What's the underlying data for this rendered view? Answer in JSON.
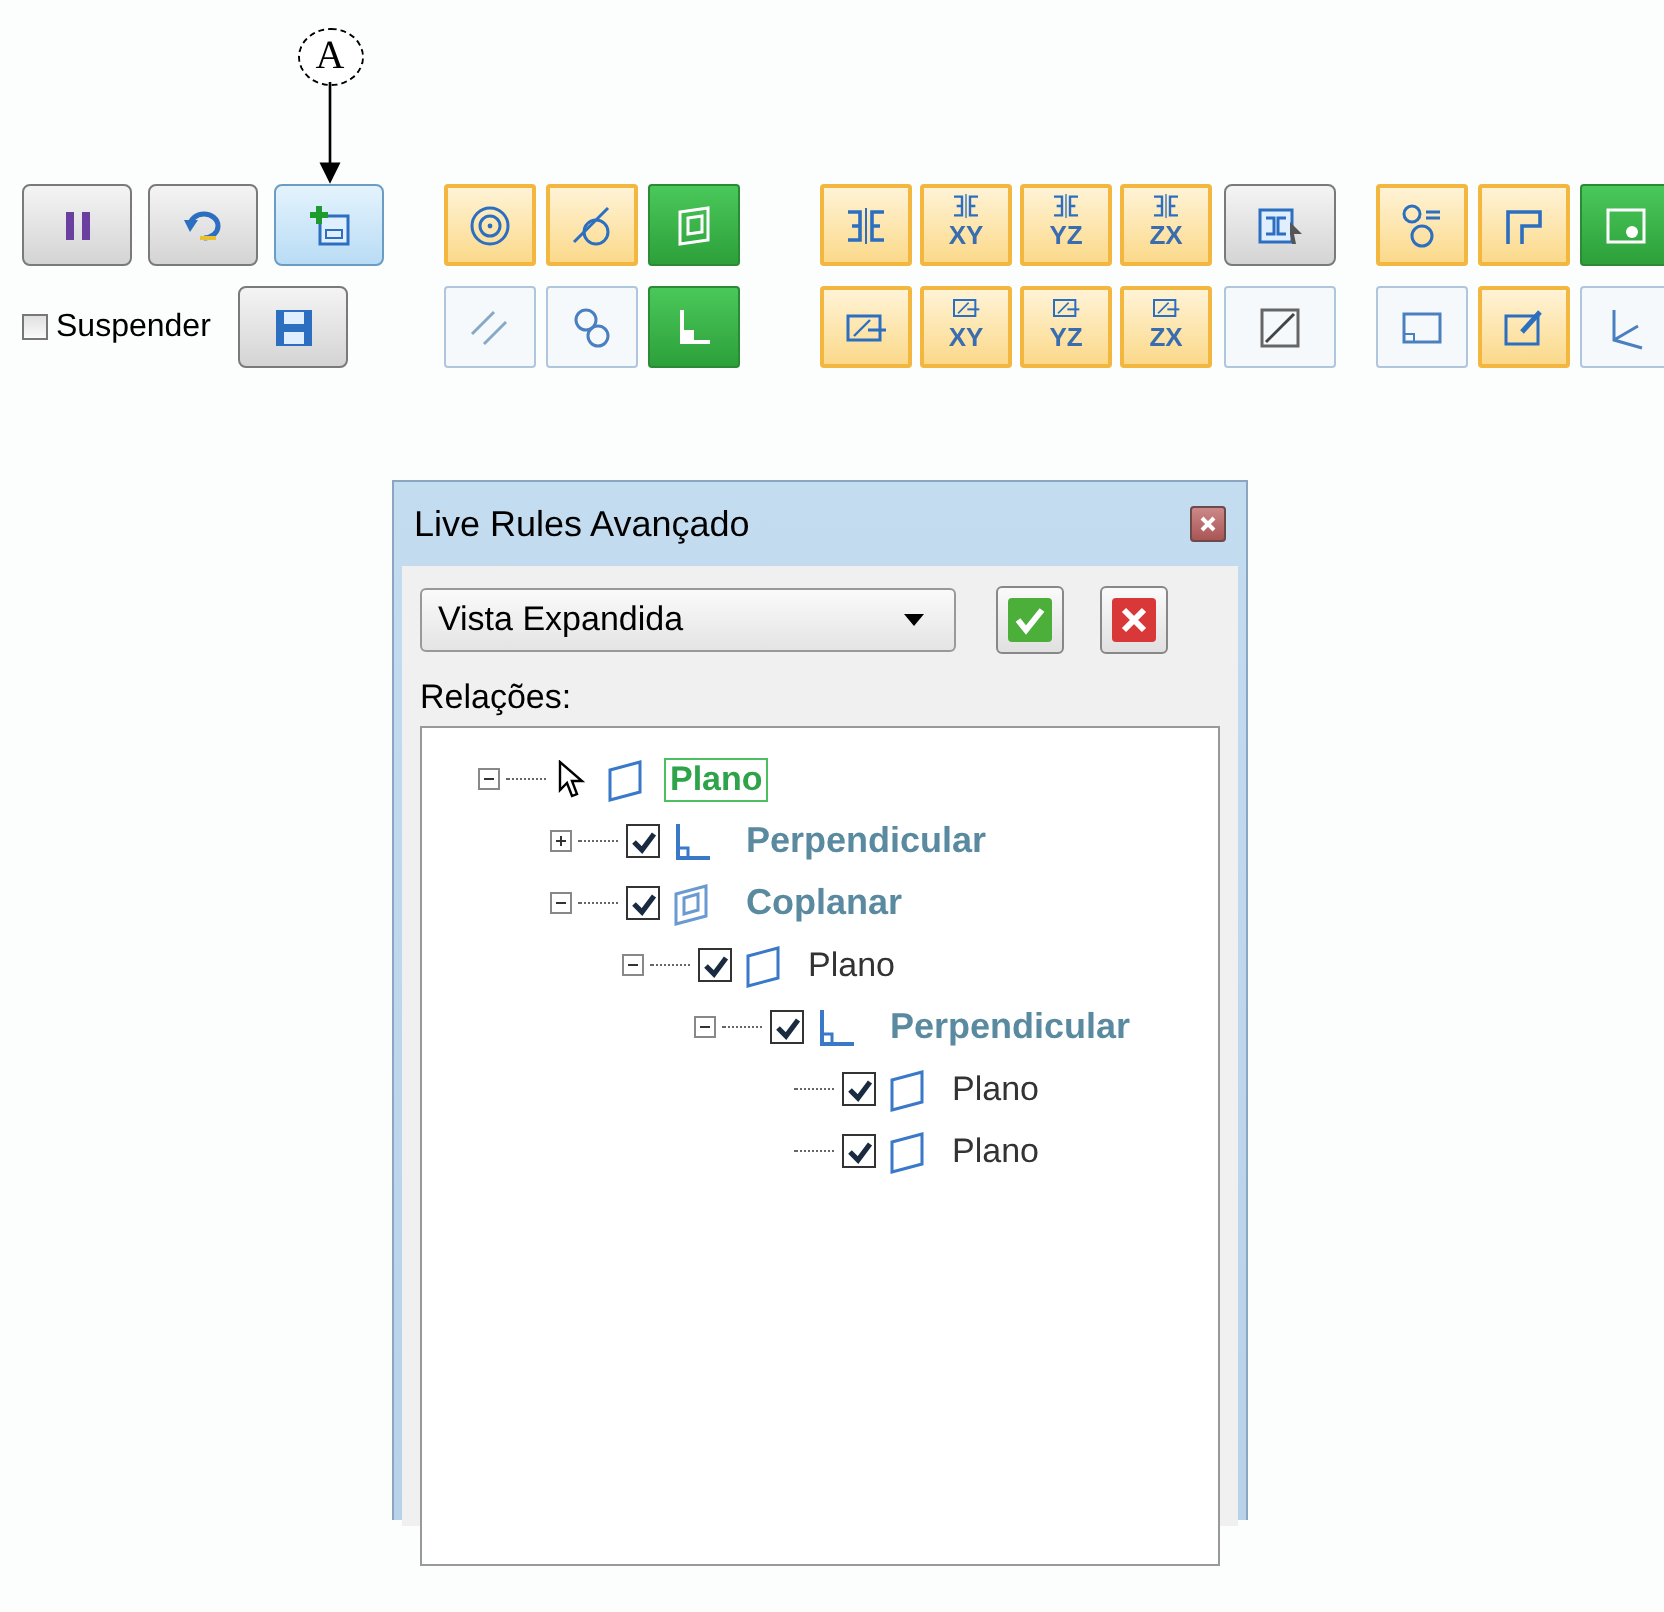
{
  "callout": {
    "label": "A"
  },
  "toolbar": {
    "rows": [
      {
        "groups": [
          [
            {
              "kind": "pause",
              "active": false
            },
            {
              "kind": "undo",
              "active": false
            },
            {
              "kind": "add-plane",
              "active": true
            }
          ],
          [
            {
              "kind": "concentric",
              "on": true,
              "active": false
            },
            {
              "kind": "tangent",
              "on": true,
              "active": false
            },
            {
              "kind": "coplanar",
              "on": true,
              "active": true
            }
          ],
          [
            {
              "kind": "symmetric",
              "on": true,
              "active": false
            },
            {
              "kind": "symmetric",
              "on": true,
              "active": false,
              "label": "XY"
            },
            {
              "kind": "symmetric",
              "on": true,
              "active": false,
              "label": "YZ"
            },
            {
              "kind": "symmetric",
              "on": true,
              "active": false,
              "label": "ZX"
            },
            {
              "kind": "symmetric-select",
              "active": false
            }
          ],
          [
            {
              "kind": "equal-circles",
              "on": true,
              "active": false
            },
            {
              "kind": "step",
              "on": true,
              "active": false
            },
            {
              "kind": "region",
              "on": true,
              "active": true
            }
          ]
        ]
      },
      {
        "groups": [
          [
            {
              "kind": "checkbox",
              "label": "Suspender",
              "checked": false
            },
            {
              "kind": "save",
              "active": false
            }
          ],
          [
            {
              "kind": "parallel",
              "on": false,
              "active": false
            },
            {
              "kind": "circles",
              "on": false,
              "active": false
            },
            {
              "kind": "perpendicular",
              "on": true,
              "active": true
            }
          ],
          [
            {
              "kind": "plane",
              "on": true,
              "active": false
            },
            {
              "kind": "plane",
              "on": true,
              "active": false,
              "label": "XY"
            },
            {
              "kind": "plane",
              "on": true,
              "active": false,
              "label": "YZ"
            },
            {
              "kind": "plane",
              "on": true,
              "active": false,
              "label": "ZX"
            },
            {
              "kind": "diagonal",
              "on": false,
              "active": false
            }
          ],
          [
            {
              "kind": "rectangle",
              "on": false,
              "active": false
            },
            {
              "kind": "edit-plane",
              "on": true,
              "active": false
            },
            {
              "kind": "axes",
              "on": false,
              "active": false
            }
          ]
        ]
      }
    ]
  },
  "dialog": {
    "title": "Live Rules Avançado",
    "view_select": {
      "value": "Vista Expandida"
    },
    "buttons": [
      {
        "kind": "ok"
      },
      {
        "kind": "cancel"
      }
    ],
    "relations_label": "Relações:",
    "tree": [
      {
        "label": "Plano",
        "kind": "face",
        "selected": true,
        "expanded": true,
        "children": [
          {
            "label": "Perpendicular",
            "kind": "perpendicular",
            "selected": false,
            "checked": true,
            "expanded": false
          },
          {
            "label": "Coplanar",
            "kind": "coplanar",
            "selected": false,
            "checked": true,
            "expanded": true,
            "children": [
              {
                "label": "Plano",
                "kind": "face",
                "selected": false,
                "checked": true,
                "expanded": true,
                "children": [
                  {
                    "label": "Perpendicular",
                    "kind": "perpendicular",
                    "selected": false,
                    "checked": true,
                    "expanded": true,
                    "children": [
                      {
                        "label": "Plano",
                        "kind": "face",
                        "selected": false,
                        "checked": true
                      },
                      {
                        "label": "Plano",
                        "kind": "face",
                        "selected": false,
                        "checked": true
                      }
                    ]
                  }
                ]
              }
            ]
          }
        ]
      }
    ]
  }
}
